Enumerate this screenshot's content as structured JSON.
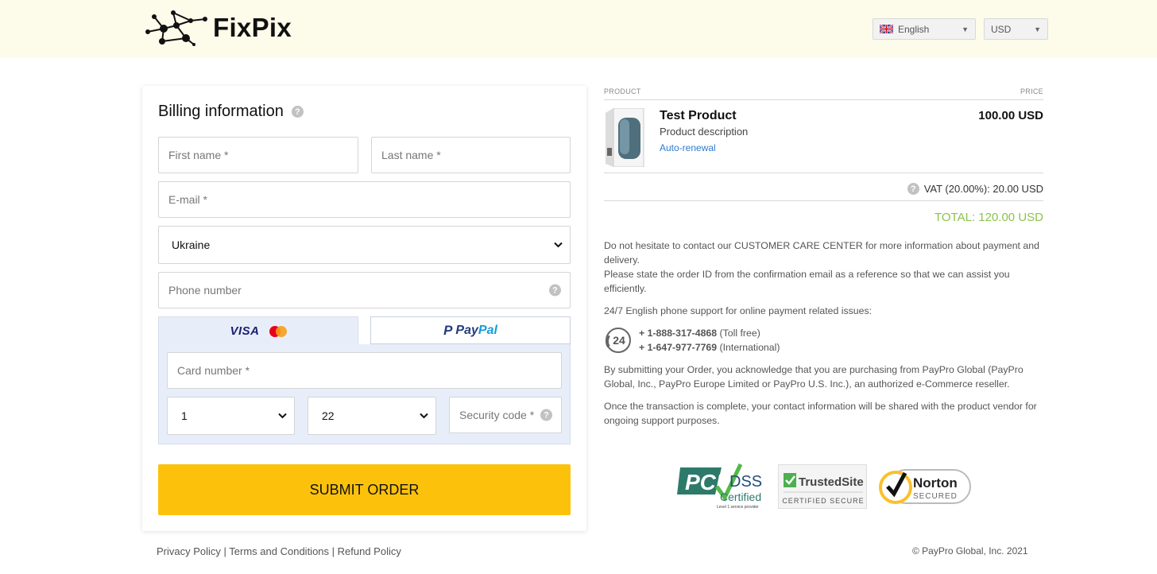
{
  "header": {
    "brand": "FixPix",
    "language": "English",
    "currency": "USD"
  },
  "billing": {
    "title": "Billing information",
    "first_name_placeholder": "First name *",
    "last_name_placeholder": "Last name *",
    "email_placeholder": "E-mail *",
    "country": "Ukraine",
    "phone_placeholder": "Phone number",
    "card_number_placeholder": "Card number *",
    "exp_month": "1",
    "exp_year": "22",
    "security_code_placeholder": "Security code *",
    "tab_card_label": "VISA",
    "tab_paypal_pay": "Pay",
    "tab_paypal_pal": "Pal",
    "submit_label": "SUBMIT ORDER"
  },
  "footer": {
    "privacy": "Privacy Policy",
    "terms": "Terms and Conditions",
    "refund": "Refund Policy",
    "copyright": "© PayPro Global, Inc. 2021"
  },
  "order": {
    "col_product": "PRODUCT",
    "col_price": "PRICE",
    "product_name": "Test Product",
    "product_description": "Product description",
    "auto_renewal": "Auto-renewal",
    "price": "100.00 USD",
    "vat": "VAT (20.00%): 20.00 USD",
    "total": "TOTAL: 120.00 USD"
  },
  "info": {
    "contact_text": "Do not hesitate to contact our CUSTOMER CARE CENTER for more information about payment and delivery.",
    "order_id_text": "Please state the order ID from the confirmation email as a reference so that we can assist you efficiently.",
    "support_text": "24/7 English phone support for online payment related issues:",
    "phone1": "+ 1-888-317-4868",
    "phone1_note": "(Toll free)",
    "phone2": "+ 1-647-977-7769",
    "phone2_note": "(International)",
    "support_badge": "24",
    "reseller_text": "By submitting your Order, you acknowledge that you are purchasing from PayPro Global (PayPro Global, Inc., PayPro Europe Limited or PayPro U.S. Inc.), an authorized e-Commerce reseller.",
    "vendor_text": "Once the transaction is complete, your contact information will be shared with the product vendor for ongoing support purposes."
  },
  "badges": {
    "pci_title": "DSS",
    "pci_sub": "Certified",
    "pci_small": "Level 1 service provider",
    "trusted_title": "TrustedSite",
    "trusted_sub": "CERTIFIED SECURE",
    "norton_title": "Norton",
    "norton_sub": "SECURED"
  },
  "colors": {
    "header_bg": "#fdfbea",
    "submit": "#fcc20b",
    "total": "#8bc34a",
    "link": "#2f7ccf",
    "pay_panel": "#e8eef9"
  }
}
